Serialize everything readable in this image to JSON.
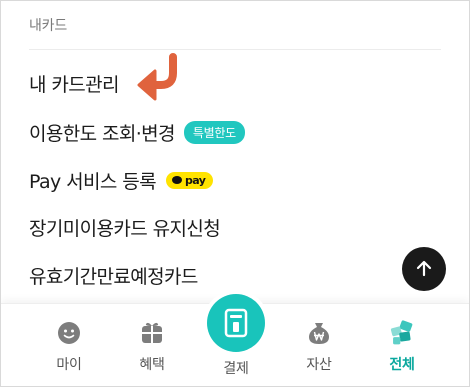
{
  "section": {
    "title": "내카드"
  },
  "menu": {
    "items": [
      {
        "label": "내 카드관리"
      },
      {
        "label": "이용한도 조회·변경",
        "badge": "특별한도"
      },
      {
        "label": "Pay 서비스 등록",
        "badge": "pay"
      },
      {
        "label": "장기미이용카드 유지신청"
      },
      {
        "label": "유효기간만료예정카드"
      }
    ]
  },
  "icons": {
    "arrow": "curved-arrow-left-icon",
    "scroll_top": "arrow-up-icon",
    "my": "smiley-face-icon",
    "benefit": "gift-box-icon",
    "pay": "card-slot-icon",
    "asset": "won-bag-icon",
    "all": "all-menu-icon"
  },
  "colors": {
    "accent": "#19c4bb",
    "arrow": "#e0633d",
    "pay_badge": "#ffe300",
    "active_tab": "#0aa89e"
  },
  "tabbar": {
    "tabs": [
      {
        "label": "마이"
      },
      {
        "label": "혜택"
      },
      {
        "label": "결제"
      },
      {
        "label": "자산"
      },
      {
        "label": "전체",
        "active": true
      }
    ]
  }
}
